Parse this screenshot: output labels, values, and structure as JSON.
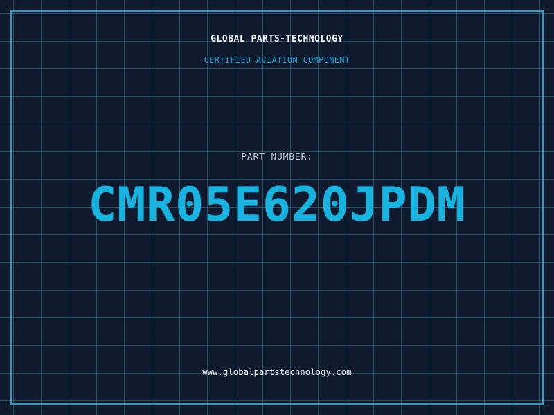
{
  "header": {
    "brand": "GLOBAL PARTS-TECHNOLOGY",
    "subtitle": "CERTIFIED AVIATION COMPONENT"
  },
  "part": {
    "label": "PART NUMBER:",
    "number": "CMR05E620JPDM"
  },
  "footer": {
    "website": "www.globalpartstechnology.com"
  },
  "colors": {
    "background": "#0f1a2e",
    "grid": "#28788c",
    "accent": "#19b3e0",
    "frame": "#1fa3c9",
    "text": "#f2f4f7",
    "label": "#b8c2cf"
  }
}
